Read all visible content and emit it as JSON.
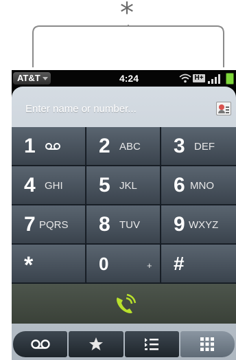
{
  "annotation": {
    "marker": "*"
  },
  "status_bar": {
    "carrier": "AT&T",
    "time": "4:24",
    "network_type": "H+"
  },
  "dialer": {
    "entry_placeholder": "Enter name or number...",
    "keys": [
      {
        "digit": "1",
        "letters": "",
        "icon": "voicemail-icon"
      },
      {
        "digit": "2",
        "letters": "ABC"
      },
      {
        "digit": "3",
        "letters": "DEF"
      },
      {
        "digit": "4",
        "letters": "GHI"
      },
      {
        "digit": "5",
        "letters": "JKL"
      },
      {
        "digit": "6",
        "letters": "MNO"
      },
      {
        "digit": "7",
        "letters": "PQRS"
      },
      {
        "digit": "8",
        "letters": "TUV"
      },
      {
        "digit": "9",
        "letters": "WXYZ"
      },
      {
        "digit": "*",
        "letters": ""
      },
      {
        "digit": "0",
        "letters": "+"
      },
      {
        "digit": "#",
        "letters": ""
      }
    ],
    "call_icon": "phone-call-icon"
  },
  "bottom_nav": {
    "items": [
      {
        "icon": "voicemail-icon"
      },
      {
        "icon": "star-icon"
      },
      {
        "icon": "call-log-icon"
      },
      {
        "icon": "dialpad-icon",
        "selected": true
      }
    ]
  },
  "colors": {
    "call_green": "#b8e02c",
    "battery_green": "#7ed63a",
    "keypad_bg": "#111821"
  }
}
